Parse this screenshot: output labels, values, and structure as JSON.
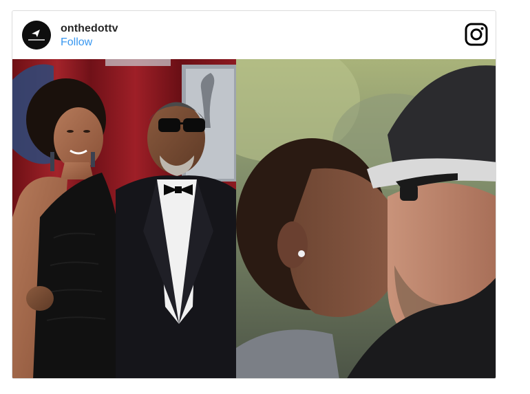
{
  "post": {
    "username": "onthedottv",
    "follow_label": "Follow",
    "avatar_icon": "account-avatar-icon",
    "platform_icon": "instagram-icon"
  },
  "photo": {
    "left_panel": "red-carpet-couple-photo",
    "right_panel": "couple-kissing-photo"
  },
  "colors": {
    "follow_blue": "#3897f0",
    "username_text": "#262626",
    "border": "#dbdbdb",
    "curtain_red": "#8b1a1f"
  }
}
